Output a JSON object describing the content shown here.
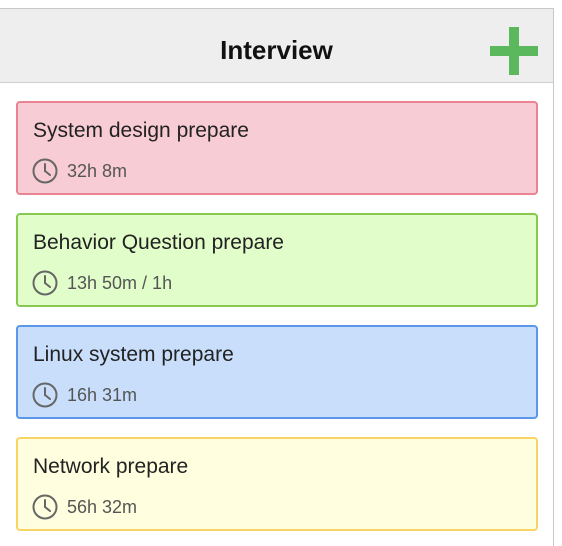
{
  "header": {
    "title": "Interview",
    "add_icon": "plus-icon",
    "add_color": "#5cb85c"
  },
  "cards": [
    {
      "title": "System design prepare",
      "time": "32h 8m",
      "icon": "clock-icon",
      "bg": "#f8ccd5",
      "border": "#ea8394"
    },
    {
      "title": "Behavior Question prepare",
      "time": "13h 50m / 1h",
      "icon": "clock-icon",
      "bg": "#e1fdca",
      "border": "#86c94e"
    },
    {
      "title": "Linux system prepare",
      "time": "16h 31m",
      "icon": "clock-icon",
      "bg": "#c9defb",
      "border": "#5b98ea"
    },
    {
      "title": "Network prepare",
      "time": "56h 32m",
      "icon": "clock-icon",
      "bg": "#ffffdf",
      "border": "#f7d563"
    }
  ]
}
